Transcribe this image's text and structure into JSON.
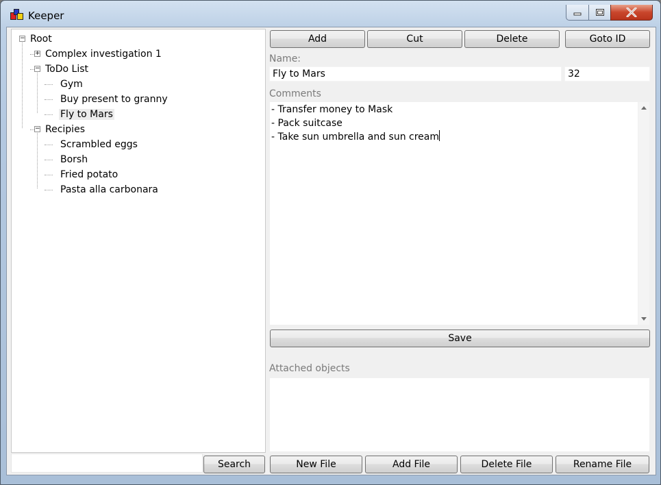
{
  "window": {
    "title": "Keeper"
  },
  "tree": {
    "items": [
      {
        "label": "Root",
        "level": 0,
        "expander": "minus",
        "selected": false
      },
      {
        "label": "Complex investigation 1",
        "level": 1,
        "expander": "plus",
        "selected": false
      },
      {
        "label": "ToDo List",
        "level": 1,
        "expander": "minus",
        "selected": false
      },
      {
        "label": "Gym",
        "level": 2,
        "expander": "none",
        "selected": false
      },
      {
        "label": "Buy present to granny",
        "level": 2,
        "expander": "none",
        "selected": false
      },
      {
        "label": "Fly to Mars",
        "level": 2,
        "expander": "none",
        "selected": true
      },
      {
        "label": "Recipies",
        "level": 1,
        "expander": "minus",
        "selected": false
      },
      {
        "label": "Scrambled eggs",
        "level": 2,
        "expander": "none",
        "selected": false
      },
      {
        "label": "Borsh",
        "level": 2,
        "expander": "none",
        "selected": false
      },
      {
        "label": "Fried potato",
        "level": 2,
        "expander": "none",
        "selected": false
      },
      {
        "label": "Pasta alla carbonara",
        "level": 2,
        "expander": "none",
        "selected": false
      }
    ]
  },
  "toolbar": {
    "add": "Add",
    "cut": "Cut",
    "delete": "Delete",
    "goto_id": "Goto ID"
  },
  "details": {
    "name_label": "Name:",
    "name_value": "Fly to Mars",
    "id_value": "32",
    "comments_label": "Comments",
    "comment_lines": [
      "- Transfer money to Mask",
      "- Pack suitcase",
      "- Take sun umbrella and sun cream"
    ],
    "save": "Save",
    "attached_label": "Attached objects"
  },
  "footer": {
    "search": "Search",
    "search_value": "",
    "new_file": "New File",
    "add_file": "Add File",
    "delete_file": "Delete File",
    "rename_file": "Rename File"
  },
  "colors": {
    "selected_bg": "#ececec",
    "label_gray": "#7a7a7a",
    "close_red": "#c9462c"
  },
  "icons": {
    "app": "keeper-app-icon",
    "minimize": "minimize-icon",
    "maximize": "maximize-icon",
    "close": "close-icon"
  }
}
